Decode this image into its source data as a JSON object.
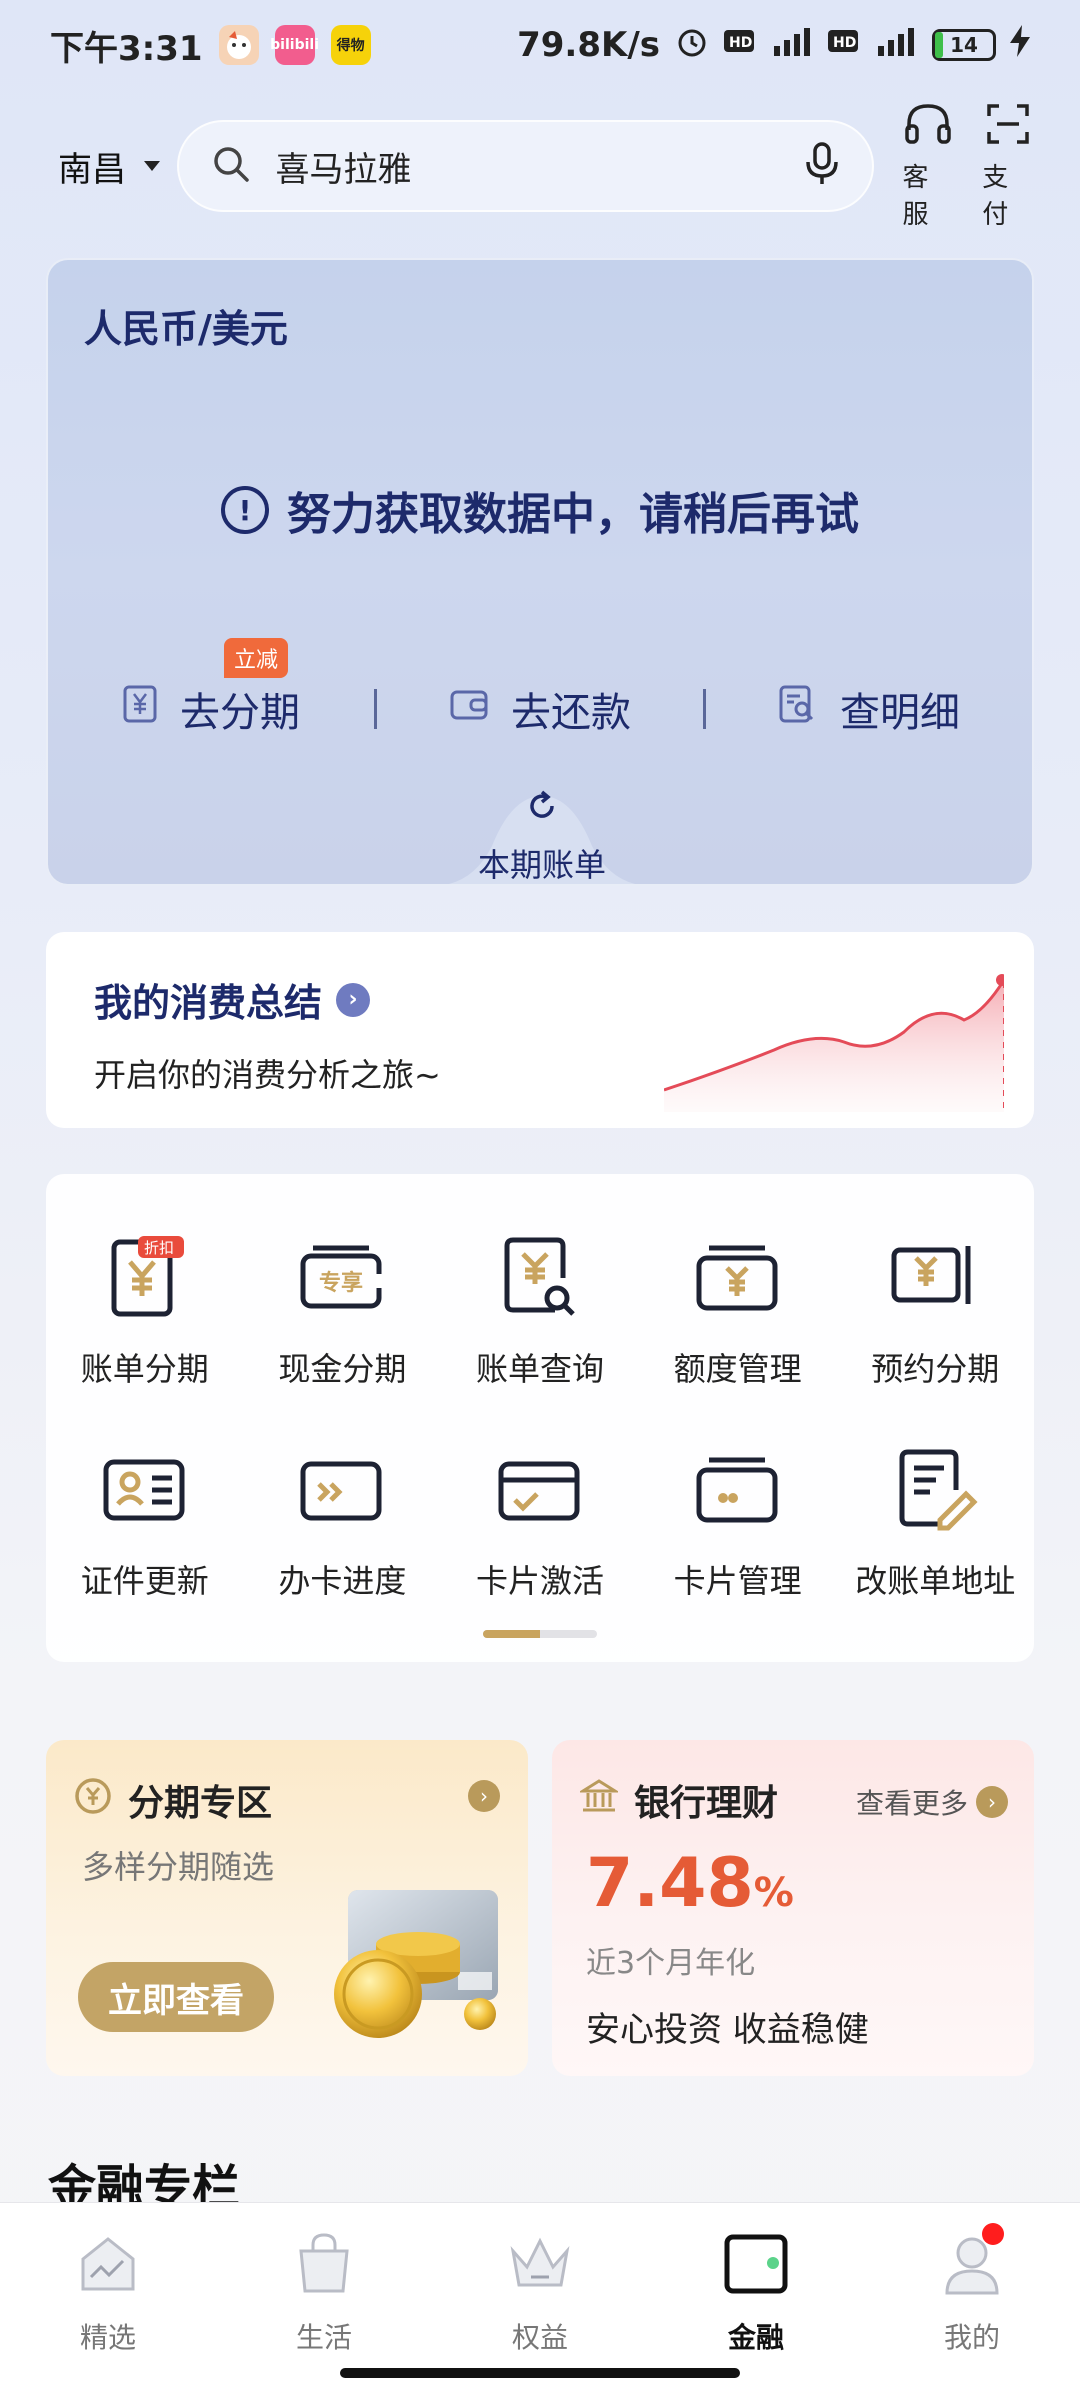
{
  "status_bar": {
    "time": "下午3:31",
    "network_speed": "79.8K/s",
    "battery_level": "14",
    "app_badges": [
      "bilibili",
      "得物"
    ]
  },
  "header": {
    "city": "南昌",
    "search_text": "喜马拉雅",
    "service_label": "客服",
    "pay_label": "支付"
  },
  "bill_card": {
    "title": "人民币/美元",
    "message": "努力获取数据中，请稍后再试",
    "actions": [
      {
        "label": "去分期",
        "badge": "立减"
      },
      {
        "label": "去还款"
      },
      {
        "label": "查明细"
      }
    ],
    "tab_label": "本期账单"
  },
  "summary": {
    "title": "我的消费总结",
    "subtitle": "开启你的消费分析之旅~"
  },
  "services": [
    {
      "label": "账单分期",
      "icon": "bill-installment-icon",
      "badge": "折扣"
    },
    {
      "label": "现金分期",
      "icon": "cash-installment-icon"
    },
    {
      "label": "账单查询",
      "icon": "bill-query-icon"
    },
    {
      "label": "额度管理",
      "icon": "credit-limit-icon"
    },
    {
      "label": "预约分期",
      "icon": "scheduled-installment-icon"
    },
    {
      "label": "证件更新",
      "icon": "id-update-icon"
    },
    {
      "label": "办卡进度",
      "icon": "card-progress-icon"
    },
    {
      "label": "卡片激活",
      "icon": "card-activate-icon"
    },
    {
      "label": "卡片管理",
      "icon": "card-manage-icon"
    },
    {
      "label": "改账单地址",
      "icon": "bill-address-icon"
    }
  ],
  "promo_installment": {
    "title": "分期专区",
    "subtitle": "多样分期随选",
    "button": "立即查看"
  },
  "promo_wealth": {
    "title": "银行理财",
    "more": "查看更多",
    "rate_value": "7.48",
    "rate_unit": "%",
    "rate_desc": "近3个月年化",
    "tagline": "安心投资 收益稳健"
  },
  "section_title": "金融专栏",
  "bottom_nav": [
    {
      "label": "精选",
      "icon": "featured-icon",
      "active": false
    },
    {
      "label": "生活",
      "icon": "life-bag-icon",
      "active": false
    },
    {
      "label": "权益",
      "icon": "crown-icon",
      "active": false
    },
    {
      "label": "金融",
      "icon": "wallet-icon",
      "active": true
    },
    {
      "label": "我的",
      "icon": "profile-icon",
      "active": false,
      "dot": true
    }
  ],
  "colors": {
    "primary_navy": "#1d2a6b",
    "accent_gold": "#c3a466",
    "rate_orange": "#e55b36",
    "badge_orange": "#f06a3b"
  }
}
